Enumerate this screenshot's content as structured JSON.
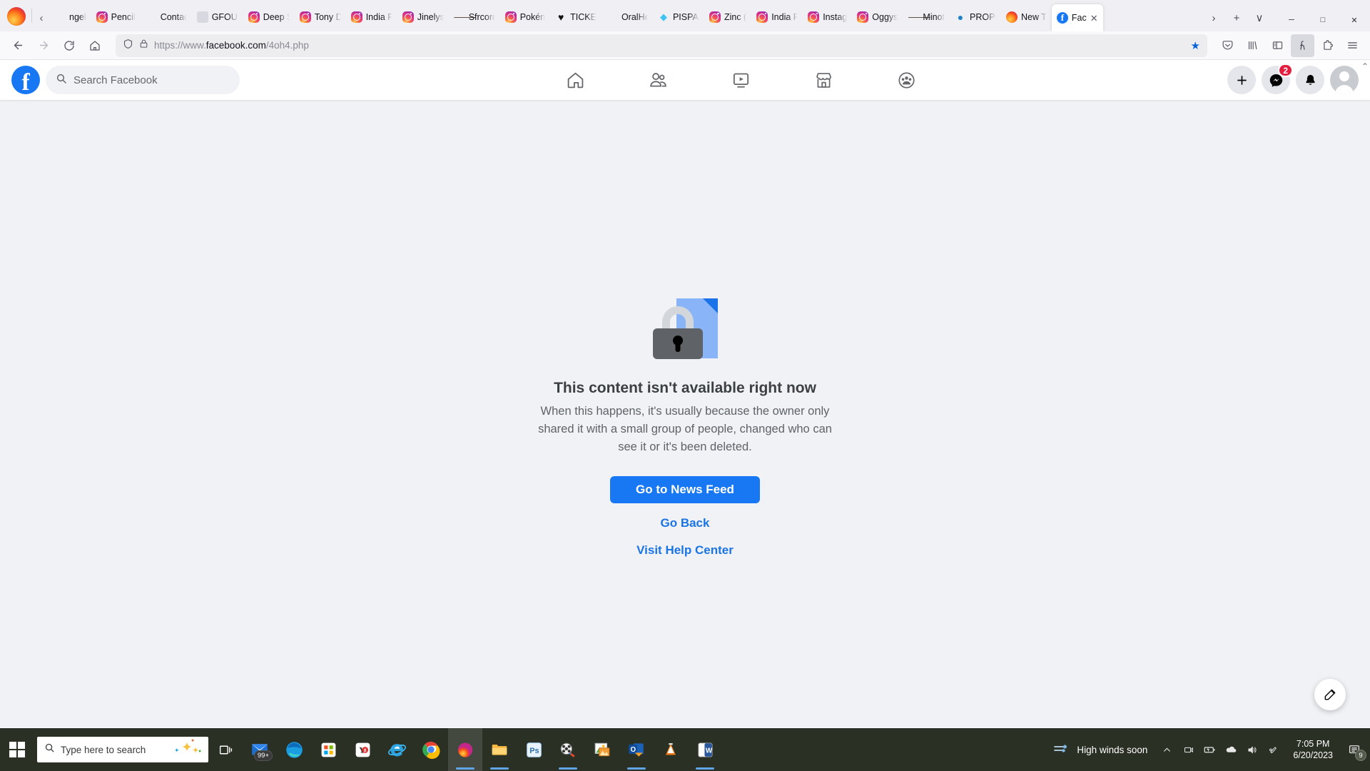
{
  "browser": {
    "tabs": [
      {
        "label": "ngel",
        "favicon": "none"
      },
      {
        "label": "Pencil",
        "favicon": "instagram"
      },
      {
        "label": "Contact",
        "favicon": "none"
      },
      {
        "label": "GFOUI",
        "favicon": "generic"
      },
      {
        "label": "Deep S",
        "favicon": "instagram"
      },
      {
        "label": "Tony D",
        "favicon": "instagram"
      },
      {
        "label": "India F",
        "favicon": "instagram"
      },
      {
        "label": "Jinelys",
        "favicon": "instagram"
      },
      {
        "label": "Sfrcord",
        "favicon": "star"
      },
      {
        "label": "Pokén",
        "favicon": "instagram"
      },
      {
        "label": "TICKE",
        "favicon": "heart"
      },
      {
        "label": "OralHeal™",
        "favicon": "none"
      },
      {
        "label": "PISPAR",
        "favicon": "gem"
      },
      {
        "label": "Zinc (",
        "favicon": "instagram"
      },
      {
        "label": "India F",
        "favicon": "instagram"
      },
      {
        "label": "Instag",
        "favicon": "instagram"
      },
      {
        "label": "Oggys",
        "favicon": "instagram"
      },
      {
        "label": "Minot",
        "favicon": "star"
      },
      {
        "label": "PROPO",
        "favicon": "globe"
      },
      {
        "label": "New T",
        "favicon": "firefox"
      },
      {
        "label": "Fac",
        "favicon": "facebook",
        "active": true,
        "close_label": "✕"
      }
    ],
    "tabstrip_controls": {
      "scroll_left": "‹",
      "scroll_right": "›",
      "new_tab": "+",
      "list_all_tabs": "∨"
    },
    "window_controls": {
      "minimize": "─",
      "maximize": "□",
      "close": "✕"
    },
    "nav": {
      "back": "←",
      "forward": "→",
      "reload": "↻",
      "home": "⌂"
    },
    "url": {
      "shield_icon": "shield-icon",
      "lock_icon": "lock-icon",
      "prefix": "https://www.",
      "domain": "facebook.com",
      "path": "/4oh4.php",
      "bookmark_star": "★"
    },
    "toolbar_right": [
      {
        "name": "pocket-icon",
        "glyph": "▽"
      },
      {
        "name": "library-icon",
        "glyph": "‖∖"
      },
      {
        "name": "sidebar-icon",
        "glyph": "▤"
      },
      {
        "name": "account-icon",
        "glyph": "ƙ"
      },
      {
        "name": "extensions-icon",
        "glyph": "⚗"
      },
      {
        "name": "app-menu-icon",
        "glyph": "≡"
      }
    ]
  },
  "facebook": {
    "logo_letter": "f",
    "search": {
      "placeholder": "Search Facebook",
      "icon": "search-icon"
    },
    "nav": [
      {
        "name": "home",
        "icon": "home-icon"
      },
      {
        "name": "friends",
        "icon": "friends-icon"
      },
      {
        "name": "watch",
        "icon": "video-icon"
      },
      {
        "name": "marketplace",
        "icon": "storefront-icon"
      },
      {
        "name": "groups",
        "icon": "groups-icon"
      }
    ],
    "actions": {
      "create_label": "+",
      "messenger_badge": "2"
    },
    "error": {
      "title": "This content isn't available right now",
      "description": "When this happens, it's usually because the owner only shared it with a small group of people, changed who can see it or it's been deleted.",
      "primary_button": "Go to News Feed",
      "link_back": "Go Back",
      "link_help": "Visit Help Center"
    },
    "compose_icon": "compose-pencil-icon",
    "scroll_top_glyph": "⌃"
  },
  "taskbar": {
    "start_icon": "windows-logo-icon",
    "search": {
      "placeholder": "Type here to search",
      "icon": "search-icon"
    },
    "task_view_icon": "task-view-icon",
    "pinned": [
      {
        "name": "mail",
        "badge": "99+"
      },
      {
        "name": "edge"
      },
      {
        "name": "microsoft-store"
      },
      {
        "name": "yandex"
      },
      {
        "name": "internet-explorer"
      },
      {
        "name": "chrome"
      },
      {
        "name": "firefox",
        "active": true
      },
      {
        "name": "file-explorer"
      },
      {
        "name": "photoshop",
        "label": "Ps"
      },
      {
        "name": "movie-maker"
      },
      {
        "name": "photos"
      },
      {
        "name": "outlook",
        "label": "O"
      },
      {
        "name": "vlc"
      },
      {
        "name": "word",
        "label": "W"
      }
    ],
    "weather": {
      "text": "High winds soon",
      "icon": "windy-icon"
    },
    "tray": [
      {
        "name": "show-hidden-icons",
        "glyph": "⌃"
      },
      {
        "name": "camera-icon",
        "glyph": "⬚"
      },
      {
        "name": "battery-icon",
        "glyph": "▭"
      },
      {
        "name": "onedrive-icon",
        "glyph": "☁"
      },
      {
        "name": "volume-icon",
        "glyph": "ᴠ"
      },
      {
        "name": "pen-icon",
        "glyph": "✐"
      }
    ],
    "clock": {
      "time": "7:05 PM",
      "date": "6/20/2023"
    },
    "action_center": {
      "icon": "notifications-icon",
      "badge": "9"
    }
  },
  "colors": {
    "fb_blue": "#1877f2",
    "link_blue": "#1b74e4",
    "badge_red": "#e41e3f",
    "taskbar_bg": "#2b3025"
  }
}
